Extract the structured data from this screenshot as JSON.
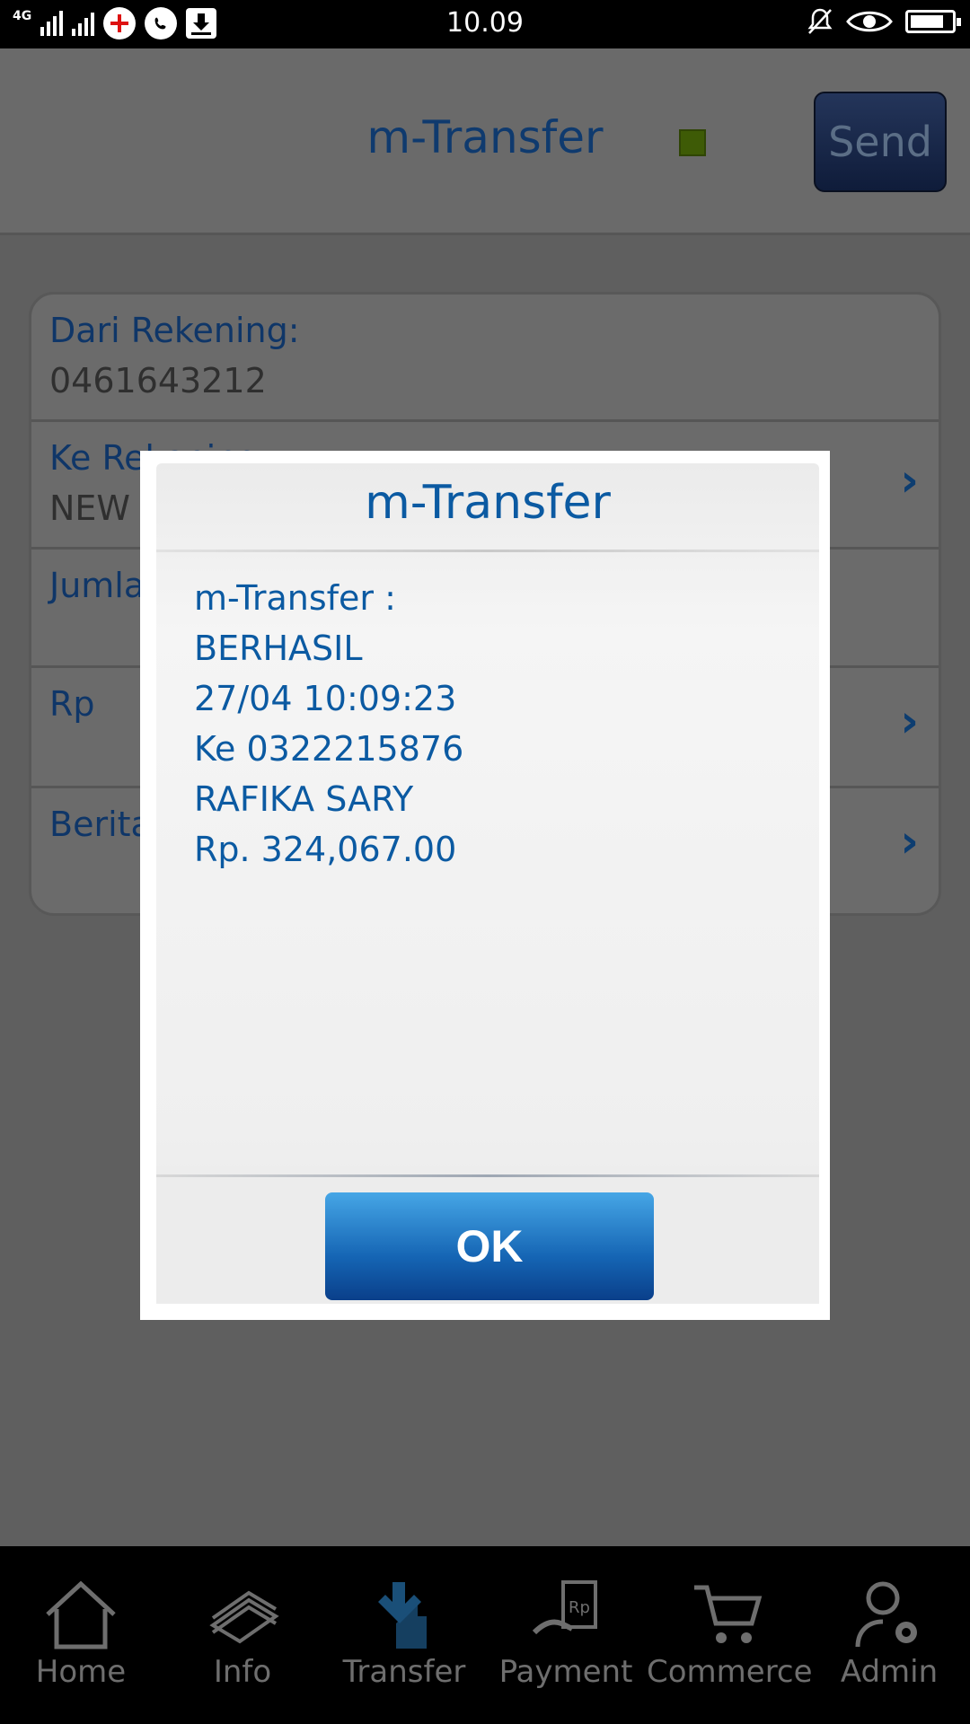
{
  "status_bar": {
    "network": "4G",
    "time": "10.09"
  },
  "header": {
    "title": "m-Transfer",
    "send_label": "Send"
  },
  "form": {
    "rows": [
      {
        "label": "Dari Rekening:",
        "value": "0461643212"
      },
      {
        "label": "Ke Rekening:",
        "value": "NEW"
      },
      {
        "label": "Jumlah",
        "value": ""
      },
      {
        "label": "Rp",
        "value": ""
      },
      {
        "label": "Berita",
        "value": ""
      }
    ]
  },
  "dialog": {
    "title": "m-Transfer",
    "lines": [
      "m-Transfer :",
      "BERHASIL",
      "27/04 10:09:23",
      "Ke 0322215876",
      "RAFIKA SARY",
      "Rp. 324,067.00"
    ],
    "ok_label": "OK"
  },
  "bottom_nav": {
    "items": [
      {
        "label": "Home",
        "icon": "home-icon"
      },
      {
        "label": "Info",
        "icon": "info-icon"
      },
      {
        "label": "Transfer",
        "icon": "transfer-icon"
      },
      {
        "label": "Payment",
        "icon": "payment-icon"
      },
      {
        "label": "Commerce",
        "icon": "cart-icon"
      },
      {
        "label": "Admin",
        "icon": "admin-icon"
      }
    ]
  }
}
